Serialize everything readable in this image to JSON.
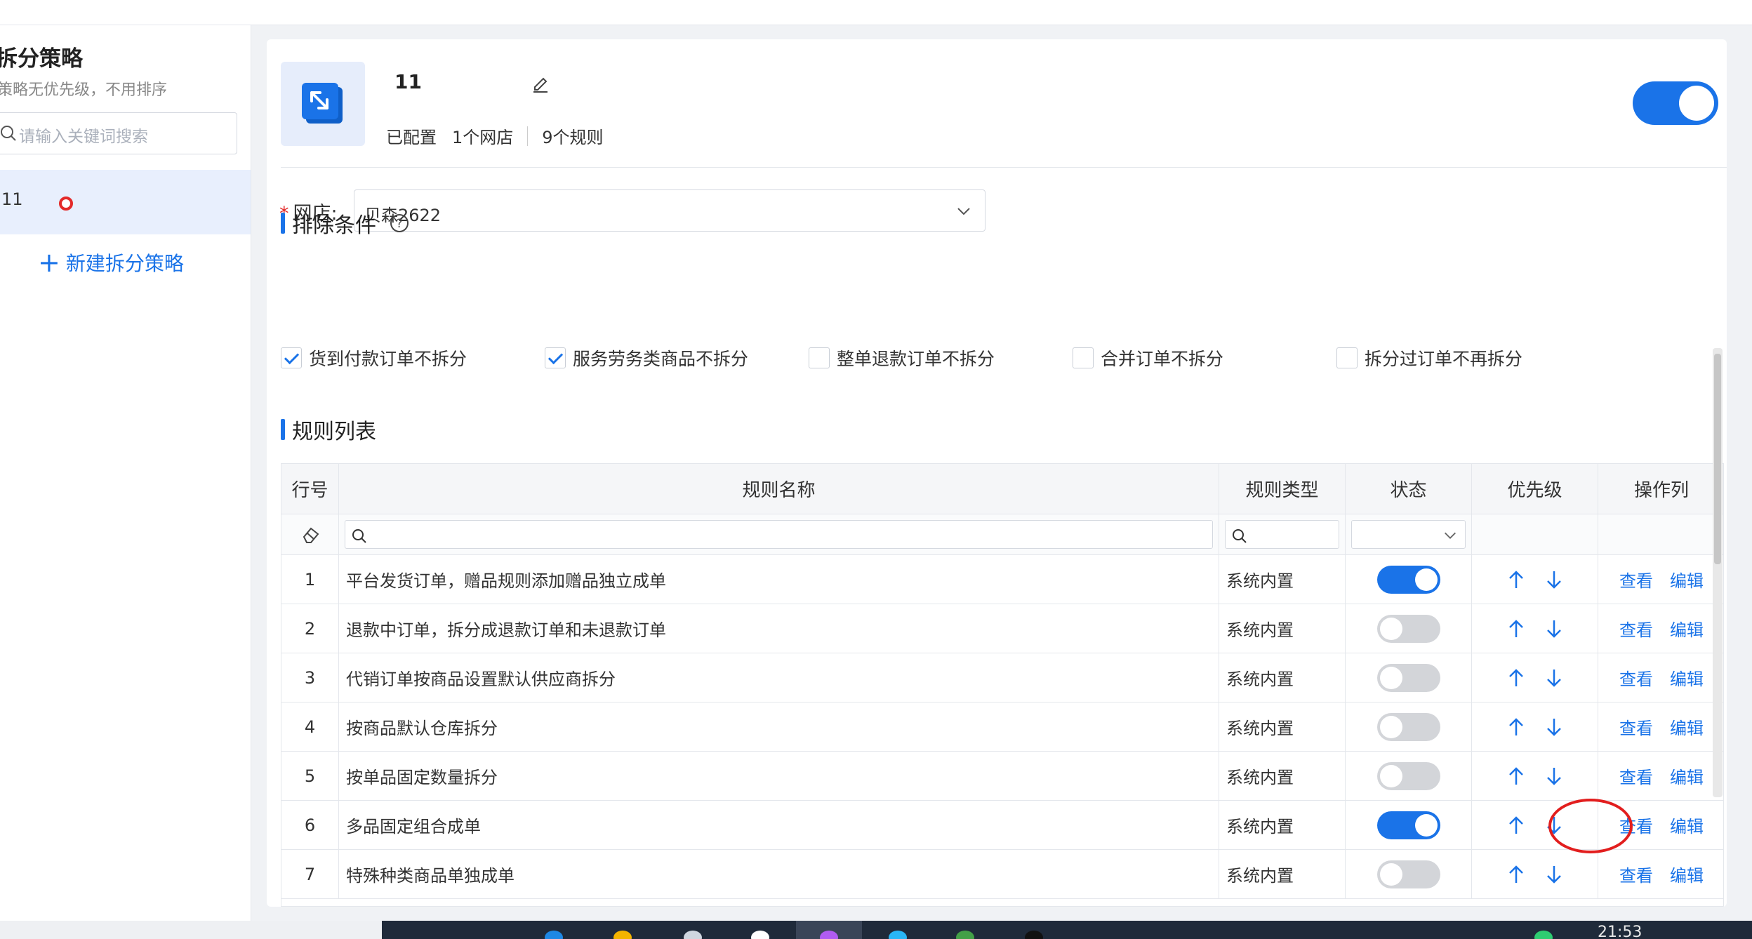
{
  "sidebar": {
    "title": "拆分策略",
    "subtitle": "策略无优先级，不用排序",
    "search_placeholder": "请输入关键词搜索",
    "selected_item": "11",
    "new_button": "新建拆分策略"
  },
  "header": {
    "strategy_name": "11",
    "status": "已配置",
    "shop_count": "1个网店",
    "rule_count": "9个规则",
    "enabled": true
  },
  "shop_field": {
    "required_mark": "*",
    "label": "网店:",
    "value": "贝森2622"
  },
  "exclude_section": {
    "title": "排除条件",
    "options": [
      {
        "label": "货到付款订单不拆分",
        "checked": true
      },
      {
        "label": "服务劳务类商品不拆分",
        "checked": true
      },
      {
        "label": "整单退款订单不拆分",
        "checked": false
      },
      {
        "label": "合并订单不拆分",
        "checked": false
      },
      {
        "label": "拆分过订单不再拆分",
        "checked": false
      }
    ]
  },
  "rules_section": {
    "title": "规则列表",
    "columns": {
      "no": "行号",
      "name": "规则名称",
      "type": "规则类型",
      "status": "状态",
      "priority": "优先级",
      "actions": "操作列"
    },
    "view_label": "查看",
    "edit_label": "编辑",
    "rows": [
      {
        "no": "1",
        "name": "平台发货订单，赠品规则添加赠品独立成单",
        "type": "系统内置",
        "on": true
      },
      {
        "no": "2",
        "name": "退款中订单，拆分成退款订单和未退款订单",
        "type": "系统内置",
        "on": false
      },
      {
        "no": "3",
        "name": "代销订单按商品设置默认供应商拆分",
        "type": "系统内置",
        "on": false
      },
      {
        "no": "4",
        "name": "按商品默认仓库拆分",
        "type": "系统内置",
        "on": false
      },
      {
        "no": "5",
        "name": "按单品固定数量拆分",
        "type": "系统内置",
        "on": false
      },
      {
        "no": "6",
        "name": "多品固定组合成单",
        "type": "系统内置",
        "on": true
      },
      {
        "no": "7",
        "name": "特殊种类商品单独成单",
        "type": "系统内置",
        "on": false
      }
    ]
  },
  "taskbar": {
    "time": "21:53"
  },
  "colors": {
    "accent": "#1a73e8",
    "annotation": "#e21e1e",
    "switch_off": "#d3d5d9"
  }
}
